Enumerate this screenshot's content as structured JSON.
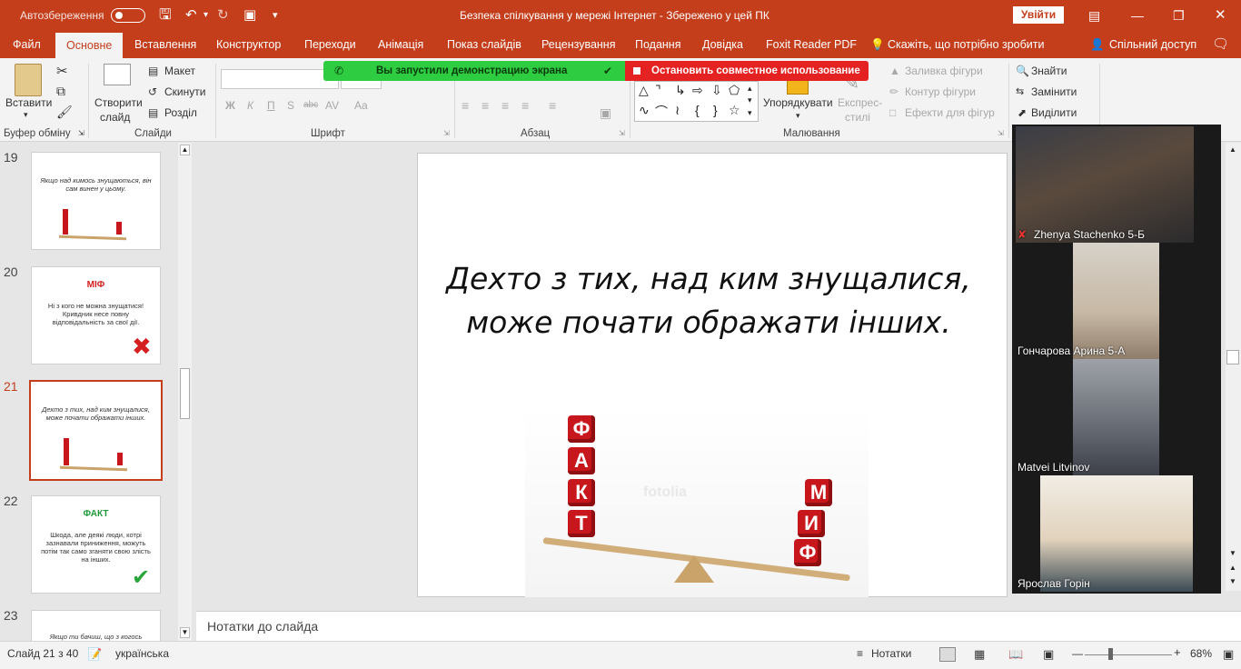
{
  "title_bar": {
    "autosave_label": "Автозбереження",
    "document_title": "Безпека спілкування у мережі Інтернет  -  Збережено у цей ПК",
    "signin_label": "Увійти"
  },
  "menu": {
    "tabs": [
      "Файл",
      "Основне",
      "Вставлення",
      "Конструктор",
      "Переходи",
      "Анімація",
      "Показ слайдів",
      "Рецензування",
      "Подання",
      "Довідка",
      "Foxit Reader PDF"
    ],
    "active_tab": "Основне",
    "tell_me": "Скажіть, що потрібно зробити",
    "share": "Спільний доступ"
  },
  "ribbon": {
    "clipboard": {
      "paste": "Вставити",
      "group": "Буфер обміну"
    },
    "slides": {
      "new_slide_line1": "Створити",
      "new_slide_line2": "слайд",
      "layout": "Макет",
      "reset": "Скинути",
      "section": "Розділ",
      "group": "Слайди"
    },
    "font": {
      "group": "Шрифт",
      "bold": "Ж",
      "italic": "К",
      "underline": "П",
      "shadow": "S",
      "strike": "abc",
      "spacing": "AV",
      "case": "Aa"
    },
    "paragraph": {
      "group": "Абзац"
    },
    "drawing": {
      "arrange": "Упорядкувати",
      "quick_styles_line1": "Експрес-",
      "quick_styles_line2": "стилі",
      "shape_fill": "Заливка фігури",
      "shape_outline": "Контур фігури",
      "shape_effects": "Ефекти для фігур",
      "group": "Малювання"
    },
    "editing": {
      "find": "Знайти",
      "replace": "Замінити",
      "select": "Виділити"
    }
  },
  "screen_share": {
    "started": "Вы запустили демонстрацию экрана",
    "stop": "Остановить совместное использование"
  },
  "thumbnails": [
    {
      "num": "19",
      "heading": "",
      "text": "Якщо над кимось знущаються, він сам винен у цьому.",
      "selected": false
    },
    {
      "num": "20",
      "heading": "МІФ",
      "heading_color": "#d42020",
      "text": "Ні з кого не можна знущатися! Кривдник несе повну відповідальність за свої дії.",
      "selected": false
    },
    {
      "num": "21",
      "heading": "",
      "text": "Дехто з тих, над ким знущалися, може почати ображати інших.",
      "selected": true
    },
    {
      "num": "22",
      "heading": "ФАКТ",
      "heading_color": "#1f9a3a",
      "text": "Шкода, але деякі люди, котрі зазнавали приниження, можуть потім так само зганяти свою злість на інших.",
      "selected": false
    },
    {
      "num": "23",
      "heading": "",
      "text": "Якщо ти бачиш, що з когось",
      "selected": false
    }
  ],
  "slide": {
    "title": "Дехто з тих, над ким знущалися, може почати ображати інших.",
    "fact_letters": [
      "Ф",
      "А",
      "К",
      "Т"
    ],
    "myth_letters": [
      "М",
      "И",
      "Ф",
      "М",
      "И"
    ],
    "watermark": "fotolia"
  },
  "notes": {
    "placeholder": "Нотатки до слайда"
  },
  "status": {
    "slide_counter": "Слайд 21 з 40",
    "language": "українська",
    "notes_button": "Нотатки",
    "zoom": "68%"
  },
  "participants": [
    {
      "name": "Zhenya Stachenko 5-Б",
      "muted": true
    },
    {
      "name": "Гончарова Арина 5-А",
      "muted": false
    },
    {
      "name": "Matvei Litvinov",
      "muted": false
    },
    {
      "name": "Ярослав Горін",
      "muted": false
    }
  ],
  "colors": {
    "accent": "#c43e1c",
    "share_green": "#2ecc40",
    "share_red": "#e52222"
  }
}
